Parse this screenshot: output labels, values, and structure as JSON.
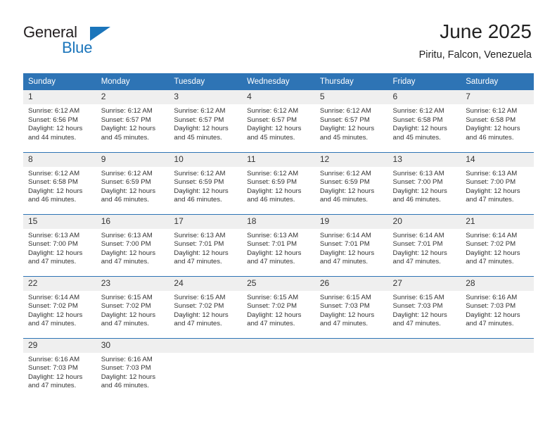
{
  "brand": {
    "name_part1": "General",
    "name_part2": "Blue",
    "accent_color": "#1b75bb"
  },
  "header": {
    "title": "June 2025",
    "subtitle": "Piritu, Falcon, Venezuela"
  },
  "colors": {
    "header_row_bg": "#2e74b5",
    "daynum_bg": "#efefef",
    "text": "#333333"
  },
  "weekday_headers": [
    "Sunday",
    "Monday",
    "Tuesday",
    "Wednesday",
    "Thursday",
    "Friday",
    "Saturday"
  ],
  "weeks": [
    [
      {
        "day": "1",
        "sunrise": "Sunrise: 6:12 AM",
        "sunset": "Sunset: 6:56 PM",
        "daylight_line1": "Daylight: 12 hours",
        "daylight_line2": "and 44 minutes."
      },
      {
        "day": "2",
        "sunrise": "Sunrise: 6:12 AM",
        "sunset": "Sunset: 6:57 PM",
        "daylight_line1": "Daylight: 12 hours",
        "daylight_line2": "and 45 minutes."
      },
      {
        "day": "3",
        "sunrise": "Sunrise: 6:12 AM",
        "sunset": "Sunset: 6:57 PM",
        "daylight_line1": "Daylight: 12 hours",
        "daylight_line2": "and 45 minutes."
      },
      {
        "day": "4",
        "sunrise": "Sunrise: 6:12 AM",
        "sunset": "Sunset: 6:57 PM",
        "daylight_line1": "Daylight: 12 hours",
        "daylight_line2": "and 45 minutes."
      },
      {
        "day": "5",
        "sunrise": "Sunrise: 6:12 AM",
        "sunset": "Sunset: 6:57 PM",
        "daylight_line1": "Daylight: 12 hours",
        "daylight_line2": "and 45 minutes."
      },
      {
        "day": "6",
        "sunrise": "Sunrise: 6:12 AM",
        "sunset": "Sunset: 6:58 PM",
        "daylight_line1": "Daylight: 12 hours",
        "daylight_line2": "and 45 minutes."
      },
      {
        "day": "7",
        "sunrise": "Sunrise: 6:12 AM",
        "sunset": "Sunset: 6:58 PM",
        "daylight_line1": "Daylight: 12 hours",
        "daylight_line2": "and 46 minutes."
      }
    ],
    [
      {
        "day": "8",
        "sunrise": "Sunrise: 6:12 AM",
        "sunset": "Sunset: 6:58 PM",
        "daylight_line1": "Daylight: 12 hours",
        "daylight_line2": "and 46 minutes."
      },
      {
        "day": "9",
        "sunrise": "Sunrise: 6:12 AM",
        "sunset": "Sunset: 6:59 PM",
        "daylight_line1": "Daylight: 12 hours",
        "daylight_line2": "and 46 minutes."
      },
      {
        "day": "10",
        "sunrise": "Sunrise: 6:12 AM",
        "sunset": "Sunset: 6:59 PM",
        "daylight_line1": "Daylight: 12 hours",
        "daylight_line2": "and 46 minutes."
      },
      {
        "day": "11",
        "sunrise": "Sunrise: 6:12 AM",
        "sunset": "Sunset: 6:59 PM",
        "daylight_line1": "Daylight: 12 hours",
        "daylight_line2": "and 46 minutes."
      },
      {
        "day": "12",
        "sunrise": "Sunrise: 6:12 AM",
        "sunset": "Sunset: 6:59 PM",
        "daylight_line1": "Daylight: 12 hours",
        "daylight_line2": "and 46 minutes."
      },
      {
        "day": "13",
        "sunrise": "Sunrise: 6:13 AM",
        "sunset": "Sunset: 7:00 PM",
        "daylight_line1": "Daylight: 12 hours",
        "daylight_line2": "and 46 minutes."
      },
      {
        "day": "14",
        "sunrise": "Sunrise: 6:13 AM",
        "sunset": "Sunset: 7:00 PM",
        "daylight_line1": "Daylight: 12 hours",
        "daylight_line2": "and 47 minutes."
      }
    ],
    [
      {
        "day": "15",
        "sunrise": "Sunrise: 6:13 AM",
        "sunset": "Sunset: 7:00 PM",
        "daylight_line1": "Daylight: 12 hours",
        "daylight_line2": "and 47 minutes."
      },
      {
        "day": "16",
        "sunrise": "Sunrise: 6:13 AM",
        "sunset": "Sunset: 7:00 PM",
        "daylight_line1": "Daylight: 12 hours",
        "daylight_line2": "and 47 minutes."
      },
      {
        "day": "17",
        "sunrise": "Sunrise: 6:13 AM",
        "sunset": "Sunset: 7:01 PM",
        "daylight_line1": "Daylight: 12 hours",
        "daylight_line2": "and 47 minutes."
      },
      {
        "day": "18",
        "sunrise": "Sunrise: 6:13 AM",
        "sunset": "Sunset: 7:01 PM",
        "daylight_line1": "Daylight: 12 hours",
        "daylight_line2": "and 47 minutes."
      },
      {
        "day": "19",
        "sunrise": "Sunrise: 6:14 AM",
        "sunset": "Sunset: 7:01 PM",
        "daylight_line1": "Daylight: 12 hours",
        "daylight_line2": "and 47 minutes."
      },
      {
        "day": "20",
        "sunrise": "Sunrise: 6:14 AM",
        "sunset": "Sunset: 7:01 PM",
        "daylight_line1": "Daylight: 12 hours",
        "daylight_line2": "and 47 minutes."
      },
      {
        "day": "21",
        "sunrise": "Sunrise: 6:14 AM",
        "sunset": "Sunset: 7:02 PM",
        "daylight_line1": "Daylight: 12 hours",
        "daylight_line2": "and 47 minutes."
      }
    ],
    [
      {
        "day": "22",
        "sunrise": "Sunrise: 6:14 AM",
        "sunset": "Sunset: 7:02 PM",
        "daylight_line1": "Daylight: 12 hours",
        "daylight_line2": "and 47 minutes."
      },
      {
        "day": "23",
        "sunrise": "Sunrise: 6:15 AM",
        "sunset": "Sunset: 7:02 PM",
        "daylight_line1": "Daylight: 12 hours",
        "daylight_line2": "and 47 minutes."
      },
      {
        "day": "24",
        "sunrise": "Sunrise: 6:15 AM",
        "sunset": "Sunset: 7:02 PM",
        "daylight_line1": "Daylight: 12 hours",
        "daylight_line2": "and 47 minutes."
      },
      {
        "day": "25",
        "sunrise": "Sunrise: 6:15 AM",
        "sunset": "Sunset: 7:02 PM",
        "daylight_line1": "Daylight: 12 hours",
        "daylight_line2": "and 47 minutes."
      },
      {
        "day": "26",
        "sunrise": "Sunrise: 6:15 AM",
        "sunset": "Sunset: 7:03 PM",
        "daylight_line1": "Daylight: 12 hours",
        "daylight_line2": "and 47 minutes."
      },
      {
        "day": "27",
        "sunrise": "Sunrise: 6:15 AM",
        "sunset": "Sunset: 7:03 PM",
        "daylight_line1": "Daylight: 12 hours",
        "daylight_line2": "and 47 minutes."
      },
      {
        "day": "28",
        "sunrise": "Sunrise: 6:16 AM",
        "sunset": "Sunset: 7:03 PM",
        "daylight_line1": "Daylight: 12 hours",
        "daylight_line2": "and 47 minutes."
      }
    ],
    [
      {
        "day": "29",
        "sunrise": "Sunrise: 6:16 AM",
        "sunset": "Sunset: 7:03 PM",
        "daylight_line1": "Daylight: 12 hours",
        "daylight_line2": "and 47 minutes."
      },
      {
        "day": "30",
        "sunrise": "Sunrise: 6:16 AM",
        "sunset": "Sunset: 7:03 PM",
        "daylight_line1": "Daylight: 12 hours",
        "daylight_line2": "and 46 minutes."
      },
      {
        "day": "",
        "sunrise": "",
        "sunset": "",
        "daylight_line1": "",
        "daylight_line2": ""
      },
      {
        "day": "",
        "sunrise": "",
        "sunset": "",
        "daylight_line1": "",
        "daylight_line2": ""
      },
      {
        "day": "",
        "sunrise": "",
        "sunset": "",
        "daylight_line1": "",
        "daylight_line2": ""
      },
      {
        "day": "",
        "sunrise": "",
        "sunset": "",
        "daylight_line1": "",
        "daylight_line2": ""
      },
      {
        "day": "",
        "sunrise": "",
        "sunset": "",
        "daylight_line1": "",
        "daylight_line2": ""
      }
    ]
  ]
}
